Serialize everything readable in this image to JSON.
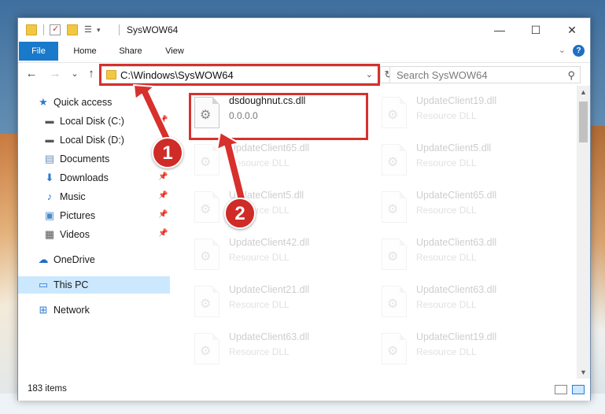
{
  "window": {
    "title": "SysWOW64",
    "controls": {
      "minimize": "—",
      "maximize": "☐",
      "close": "✕"
    }
  },
  "ribbon": {
    "tabs": [
      "File",
      "Home",
      "Share",
      "View"
    ],
    "help": "?",
    "chevron": "⌄"
  },
  "navigation": {
    "back": "←",
    "forward": "→",
    "recent": "⌄",
    "up": "↑",
    "address": "C:\\Windows\\SysWOW64",
    "refresh": "↻",
    "search_placeholder": "Search SysWOW64"
  },
  "sidebar": {
    "items": [
      {
        "label": "Quick access",
        "icon": "star-icon",
        "pinned": false
      },
      {
        "label": "Local Disk (C:)",
        "icon": "drive-icon",
        "pinned": true
      },
      {
        "label": "Local Disk (D:)",
        "icon": "drive-icon",
        "pinned": false
      },
      {
        "label": "Documents",
        "icon": "documents-icon",
        "pinned": true
      },
      {
        "label": "Downloads",
        "icon": "downloads-icon",
        "pinned": true
      },
      {
        "label": "Music",
        "icon": "music-icon",
        "pinned": true
      },
      {
        "label": "Pictures",
        "icon": "pictures-icon",
        "pinned": true
      },
      {
        "label": "Videos",
        "icon": "videos-icon",
        "pinned": true
      },
      {
        "label": "OneDrive",
        "icon": "onedrive-icon",
        "pinned": false
      },
      {
        "label": "This PC",
        "icon": "pc-icon",
        "pinned": false,
        "selected": true
      },
      {
        "label": "Network",
        "icon": "network-icon",
        "pinned": false
      }
    ]
  },
  "files": [
    {
      "name": "dsdoughnut.cs.dll",
      "sub": "0.0.0.0",
      "highlighted": true
    },
    {
      "name": "UpdateClient19.dll",
      "sub": "Resource DLL"
    },
    {
      "name": "UpdateClient65.dll",
      "sub": "Resource DLL"
    },
    {
      "name": "UpdateClient5.dll",
      "sub": "Resource DLL"
    },
    {
      "name": "UpdateClient5.dll",
      "sub": "Resource DLL"
    },
    {
      "name": "UpdateClient65.dll",
      "sub": "Resource DLL"
    },
    {
      "name": "UpdateClient42.dll",
      "sub": "Resource DLL"
    },
    {
      "name": "UpdateClient63.dll",
      "sub": "Resource DLL"
    },
    {
      "name": "UpdateClient21.dll",
      "sub": "Resource DLL"
    },
    {
      "name": "UpdateClient63.dll",
      "sub": "Resource DLL"
    },
    {
      "name": "UpdateClient63.dll",
      "sub": "Resource DLL"
    },
    {
      "name": "UpdateClient19.dll",
      "sub": "Resource DLL"
    }
  ],
  "status": {
    "item_count": "183 items"
  },
  "annotations": {
    "badge1": "1",
    "badge2": "2",
    "color": "#d8302c"
  }
}
